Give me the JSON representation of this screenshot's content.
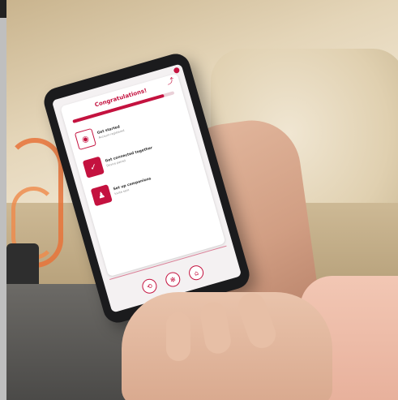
{
  "app": {
    "title": "Congratulations!",
    "progress_percent": 90,
    "accent_color": "#c4123f"
  },
  "items": [
    {
      "icon": "target-icon",
      "glyph": "◉",
      "title": "Get started",
      "subtitle": "Account registered",
      "icon_bg": "#ffffff",
      "icon_color": "#c4123f"
    },
    {
      "icon": "check-icon",
      "glyph": "✓",
      "title": "Get connected together",
      "subtitle": "Device paired",
      "icon_bg": "#c4123f",
      "icon_color": "#ffffff"
    },
    {
      "icon": "people-icon",
      "glyph": "♟",
      "title": "Set up companions",
      "subtitle": "Invite sent",
      "icon_bg": "#c4123f",
      "icon_color": "#ffffff"
    }
  ],
  "nav": [
    {
      "icon": "share-icon",
      "glyph": "⟲"
    },
    {
      "icon": "settings-icon",
      "glyph": "✻"
    },
    {
      "icon": "home-icon",
      "glyph": "⌂"
    }
  ]
}
